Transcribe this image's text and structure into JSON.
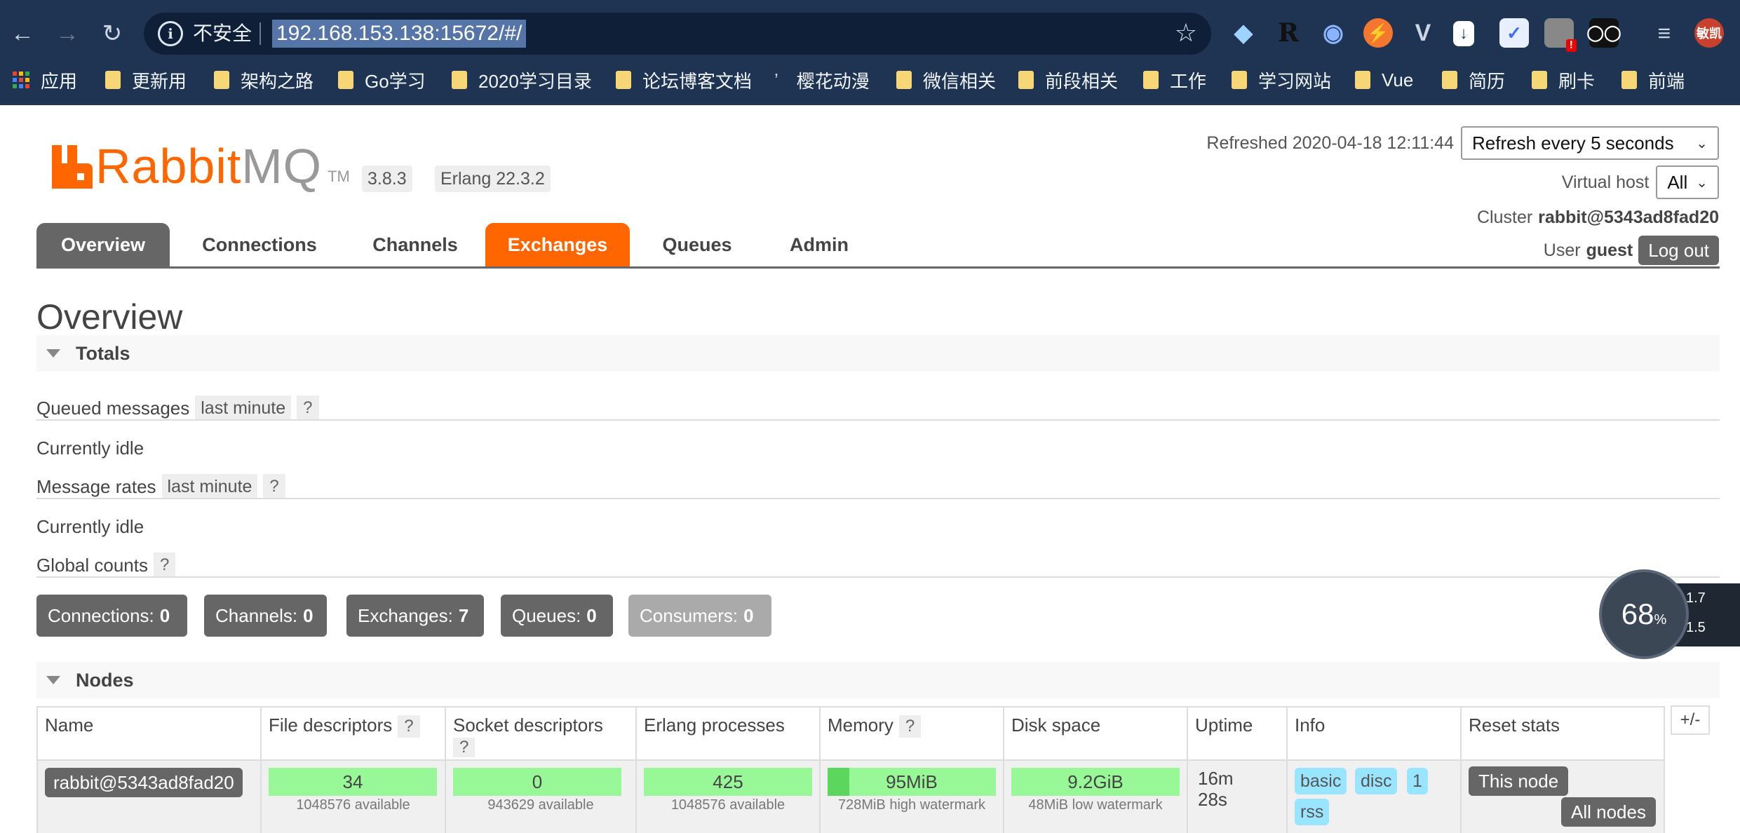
{
  "browser": {
    "insecure_label": "不安全",
    "url": "192.168.153.138:15672/#/",
    "bookmarks": [
      "应用",
      "更新用",
      "架构之路",
      "Go学习",
      "2020学习目录",
      "论坛博客文档",
      "樱花动漫",
      "微信相关",
      "前段相关",
      "工作",
      "学习网站",
      "Vue",
      "简历",
      "刷卡",
      "前端"
    ],
    "profile": "敏凯"
  },
  "header": {
    "logo_rabbit": "Rabbit",
    "logo_mq": "MQ",
    "logo_tm": "TM",
    "version": "3.8.3",
    "erlang": "Erlang 22.3.2",
    "refreshed_label": "Refreshed",
    "refreshed_at": "2020-04-18 12:11:44",
    "refresh_select": "Refresh every 5 seconds",
    "virtual_host_label": "Virtual host",
    "virtual_host_value": "All",
    "cluster_label": "Cluster",
    "cluster_name": "rabbit@5343ad8fad20",
    "user_label": "User",
    "user_name": "guest",
    "logout_label": "Log out"
  },
  "tabs": [
    "Overview",
    "Connections",
    "Channels",
    "Exchanges",
    "Queues",
    "Admin"
  ],
  "page_title": "Overview",
  "totals": {
    "heading": "Totals",
    "queued_messages_label": "Queued messages",
    "queued_range": "last minute",
    "help": "?",
    "queued_status": "Currently idle",
    "message_rates_label": "Message rates",
    "rates_range": "last minute",
    "rates_status": "Currently idle",
    "global_counts_label": "Global counts"
  },
  "counts": [
    {
      "label": "Connections:",
      "value": "0"
    },
    {
      "label": "Channels:",
      "value": "0"
    },
    {
      "label": "Exchanges:",
      "value": "7"
    },
    {
      "label": "Queues:",
      "value": "0"
    },
    {
      "label": "Consumers:",
      "value": "0"
    }
  ],
  "nodes": {
    "heading": "Nodes",
    "columns": [
      "Name",
      "File descriptors",
      "Socket descriptors",
      "Erlang processes",
      "Memory",
      "Disk space",
      "Uptime",
      "Info",
      "Reset stats"
    ],
    "toggle": "+/-",
    "row": {
      "name": "rabbit@5343ad8fad20",
      "file_descriptors": "34",
      "file_descriptors_sub": "1048576 available",
      "socket_descriptors": "0",
      "socket_descriptors_sub": "943629 available",
      "erlang_processes": "425",
      "erlang_processes_sub": "1048576 available",
      "memory": "95MiB",
      "memory_sub": "728MiB high watermark",
      "memory_fraction": 0.13,
      "disk": "9.2GiB",
      "disk_sub": "48MiB low watermark",
      "uptime_1": "16m",
      "uptime_2": "28s",
      "info_tags": [
        "basic",
        "disc",
        "1",
        "rss"
      ],
      "reset_this": "This node",
      "reset_all": "All nodes"
    }
  },
  "widget": {
    "percent": "68",
    "unit": "%",
    "up": "1.7",
    "down": "1.5"
  }
}
